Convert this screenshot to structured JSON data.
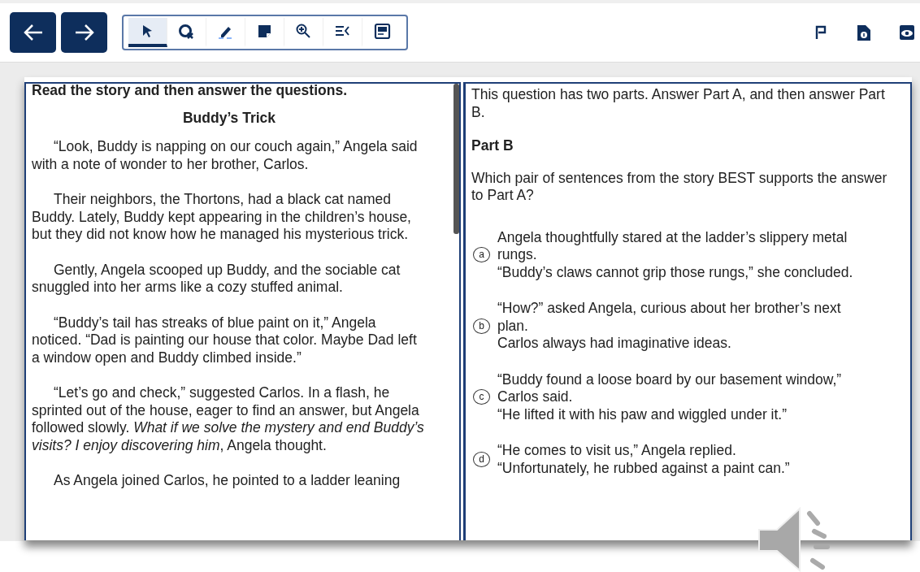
{
  "toolbar": {
    "tools": [
      {
        "kind": "pointer",
        "selected": true
      },
      {
        "kind": "line-reader",
        "selected": false
      },
      {
        "kind": "highlighter",
        "selected": false
      },
      {
        "kind": "note",
        "selected": false
      },
      {
        "kind": "zoom",
        "selected": false
      },
      {
        "kind": "line-guide",
        "selected": false
      },
      {
        "kind": "masking",
        "selected": false
      }
    ]
  },
  "passage": {
    "instruction": "Read the story and then answer the questions.",
    "title": "Buddy’s Trick",
    "paragraphs": [
      "“Look, Buddy is napping on our couch again,” Angela said with a note of wonder to her brother, Carlos.",
      "Their neighbors, the Thortons, had a black cat named Buddy. Lately, Buddy kept appearing in the children’s house, but they did not know how he managed his mysterious trick.",
      "Gently, Angela scooped up Buddy, and the sociable cat snuggled into her arms like a cozy stuffed animal.",
      "“Buddy’s tail has streaks of blue paint on it,” Angela noticed. “Dad is painting our house that color. Maybe Dad left a window open and Buddy climbed inside.”",
      "“Let’s go and check,” suggested Carlos. In a flash, he sprinted out of the house, eager to find an answer, but Angela followed slowly. *What if we solve the mystery and end Buddy’s visits? I enjoy discovering him*, Angela thought.",
      "As Angela joined Carlos, he pointed to a ladder leaning"
    ]
  },
  "question": {
    "intro": "This question has two parts. Answer Part A, and then answer Part B.",
    "part": "Part B",
    "prompt": "Which pair of sentences from the story BEST supports the answer to Part A?",
    "options": [
      {
        "letter": "a",
        "selected": false,
        "lines": [
          "Angela thoughtfully stared at the ladder’s slippery metal rungs.",
          "“Buddy’s claws cannot grip those rungs,” she concluded."
        ]
      },
      {
        "letter": "b",
        "selected": false,
        "lines": [
          "“How?” asked Angela, curious about her brother’s next plan.",
          "Carlos always had imaginative ideas."
        ]
      },
      {
        "letter": "c",
        "selected": false,
        "lines": [
          "“Buddy found a loose board by our basement window,” Carlos said.",
          "“He lifted it with his paw and wiggled under it.”"
        ]
      },
      {
        "letter": "d",
        "selected": false,
        "lines": [
          "“He comes to visit us,” Angela replied.",
          "“Unfortunately, he rubbed against a paint can.”"
        ]
      }
    ]
  }
}
